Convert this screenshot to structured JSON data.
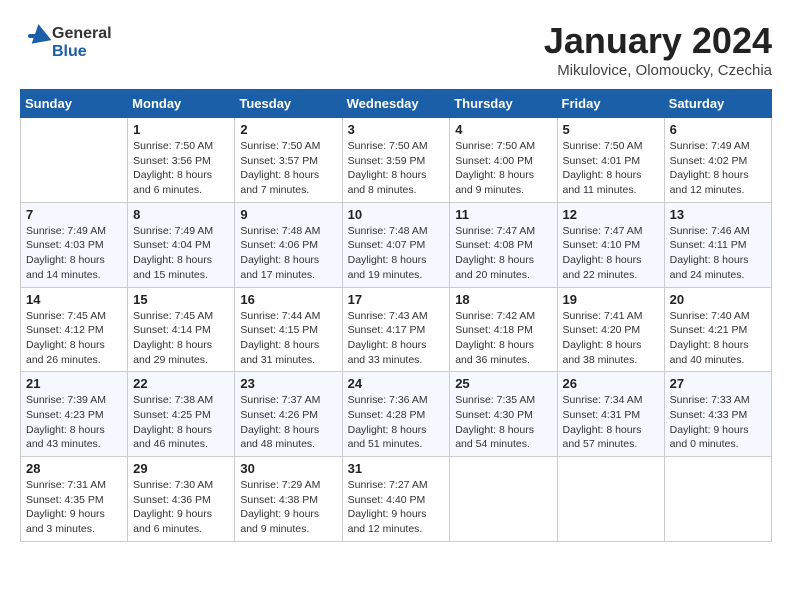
{
  "logo": {
    "line1": "General",
    "line2": "Blue"
  },
  "title": "January 2024",
  "location": "Mikulovice, Olomoucky, Czechia",
  "days_header": [
    "Sunday",
    "Monday",
    "Tuesday",
    "Wednesday",
    "Thursday",
    "Friday",
    "Saturday"
  ],
  "weeks": [
    [
      {
        "day": "",
        "info": ""
      },
      {
        "day": "1",
        "info": "Sunrise: 7:50 AM\nSunset: 3:56 PM\nDaylight: 8 hours\nand 6 minutes."
      },
      {
        "day": "2",
        "info": "Sunrise: 7:50 AM\nSunset: 3:57 PM\nDaylight: 8 hours\nand 7 minutes."
      },
      {
        "day": "3",
        "info": "Sunrise: 7:50 AM\nSunset: 3:59 PM\nDaylight: 8 hours\nand 8 minutes."
      },
      {
        "day": "4",
        "info": "Sunrise: 7:50 AM\nSunset: 4:00 PM\nDaylight: 8 hours\nand 9 minutes."
      },
      {
        "day": "5",
        "info": "Sunrise: 7:50 AM\nSunset: 4:01 PM\nDaylight: 8 hours\nand 11 minutes."
      },
      {
        "day": "6",
        "info": "Sunrise: 7:49 AM\nSunset: 4:02 PM\nDaylight: 8 hours\nand 12 minutes."
      }
    ],
    [
      {
        "day": "7",
        "info": "Sunrise: 7:49 AM\nSunset: 4:03 PM\nDaylight: 8 hours\nand 14 minutes."
      },
      {
        "day": "8",
        "info": "Sunrise: 7:49 AM\nSunset: 4:04 PM\nDaylight: 8 hours\nand 15 minutes."
      },
      {
        "day": "9",
        "info": "Sunrise: 7:48 AM\nSunset: 4:06 PM\nDaylight: 8 hours\nand 17 minutes."
      },
      {
        "day": "10",
        "info": "Sunrise: 7:48 AM\nSunset: 4:07 PM\nDaylight: 8 hours\nand 19 minutes."
      },
      {
        "day": "11",
        "info": "Sunrise: 7:47 AM\nSunset: 4:08 PM\nDaylight: 8 hours\nand 20 minutes."
      },
      {
        "day": "12",
        "info": "Sunrise: 7:47 AM\nSunset: 4:10 PM\nDaylight: 8 hours\nand 22 minutes."
      },
      {
        "day": "13",
        "info": "Sunrise: 7:46 AM\nSunset: 4:11 PM\nDaylight: 8 hours\nand 24 minutes."
      }
    ],
    [
      {
        "day": "14",
        "info": "Sunrise: 7:45 AM\nSunset: 4:12 PM\nDaylight: 8 hours\nand 26 minutes."
      },
      {
        "day": "15",
        "info": "Sunrise: 7:45 AM\nSunset: 4:14 PM\nDaylight: 8 hours\nand 29 minutes."
      },
      {
        "day": "16",
        "info": "Sunrise: 7:44 AM\nSunset: 4:15 PM\nDaylight: 8 hours\nand 31 minutes."
      },
      {
        "day": "17",
        "info": "Sunrise: 7:43 AM\nSunset: 4:17 PM\nDaylight: 8 hours\nand 33 minutes."
      },
      {
        "day": "18",
        "info": "Sunrise: 7:42 AM\nSunset: 4:18 PM\nDaylight: 8 hours\nand 36 minutes."
      },
      {
        "day": "19",
        "info": "Sunrise: 7:41 AM\nSunset: 4:20 PM\nDaylight: 8 hours\nand 38 minutes."
      },
      {
        "day": "20",
        "info": "Sunrise: 7:40 AM\nSunset: 4:21 PM\nDaylight: 8 hours\nand 40 minutes."
      }
    ],
    [
      {
        "day": "21",
        "info": "Sunrise: 7:39 AM\nSunset: 4:23 PM\nDaylight: 8 hours\nand 43 minutes."
      },
      {
        "day": "22",
        "info": "Sunrise: 7:38 AM\nSunset: 4:25 PM\nDaylight: 8 hours\nand 46 minutes."
      },
      {
        "day": "23",
        "info": "Sunrise: 7:37 AM\nSunset: 4:26 PM\nDaylight: 8 hours\nand 48 minutes."
      },
      {
        "day": "24",
        "info": "Sunrise: 7:36 AM\nSunset: 4:28 PM\nDaylight: 8 hours\nand 51 minutes."
      },
      {
        "day": "25",
        "info": "Sunrise: 7:35 AM\nSunset: 4:30 PM\nDaylight: 8 hours\nand 54 minutes."
      },
      {
        "day": "26",
        "info": "Sunrise: 7:34 AM\nSunset: 4:31 PM\nDaylight: 8 hours\nand 57 minutes."
      },
      {
        "day": "27",
        "info": "Sunrise: 7:33 AM\nSunset: 4:33 PM\nDaylight: 9 hours\nand 0 minutes."
      }
    ],
    [
      {
        "day": "28",
        "info": "Sunrise: 7:31 AM\nSunset: 4:35 PM\nDaylight: 9 hours\nand 3 minutes."
      },
      {
        "day": "29",
        "info": "Sunrise: 7:30 AM\nSunset: 4:36 PM\nDaylight: 9 hours\nand 6 minutes."
      },
      {
        "day": "30",
        "info": "Sunrise: 7:29 AM\nSunset: 4:38 PM\nDaylight: 9 hours\nand 9 minutes."
      },
      {
        "day": "31",
        "info": "Sunrise: 7:27 AM\nSunset: 4:40 PM\nDaylight: 9 hours\nand 12 minutes."
      },
      {
        "day": "",
        "info": ""
      },
      {
        "day": "",
        "info": ""
      },
      {
        "day": "",
        "info": ""
      }
    ]
  ]
}
